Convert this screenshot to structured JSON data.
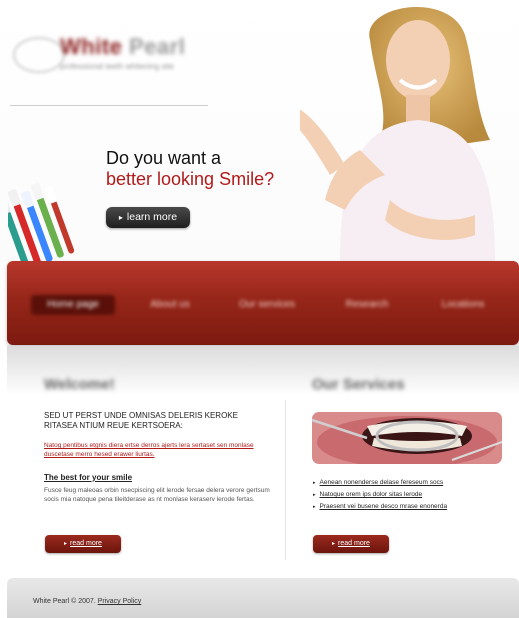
{
  "logo": {
    "title_a": "White",
    "title_b": "Pearl",
    "tagline": "professional teeth whitening site"
  },
  "hero": {
    "line1": "Do you want a",
    "line2": "better looking Smile?",
    "button": "learn more"
  },
  "nav": {
    "items": [
      "Home page",
      "About us",
      "Our services",
      "Research",
      "Locations"
    ]
  },
  "welcome": {
    "title": "Welcome!",
    "intro": "SED UT PERST UNDE OMNISAS DELERIS KEROKE RITASEA NTIUM REUE KERTSOERA:",
    "red": "Natog pentibus etgnis diera ertse derros ajerts lera sertaset sen monlase duscetase merro hesed erawer liurtas.",
    "subtitle": "The best for your smile",
    "body": "Fusce feug maleoas orbin nsecpiscing elit lerode fersae delera verore gertsum socis mia natoque pena tileitderase as nt monlase keraserv lerode fertas.",
    "read_more": "read more"
  },
  "services": {
    "title": "Our Services",
    "items": [
      "Aenean nonenderse delase fereseum socs",
      "Natoque orem ips dolor sitas lerode",
      "Praesent vei busene desco mrase enonerda"
    ],
    "read_more": "read more"
  },
  "footer": {
    "copyright": "White Pearl © 2007.",
    "privacy": "Privacy Policy"
  },
  "colors": {
    "brand_red": "#b11a1a",
    "nav_red": "#962619",
    "dark_button": "#2a2a2a"
  }
}
